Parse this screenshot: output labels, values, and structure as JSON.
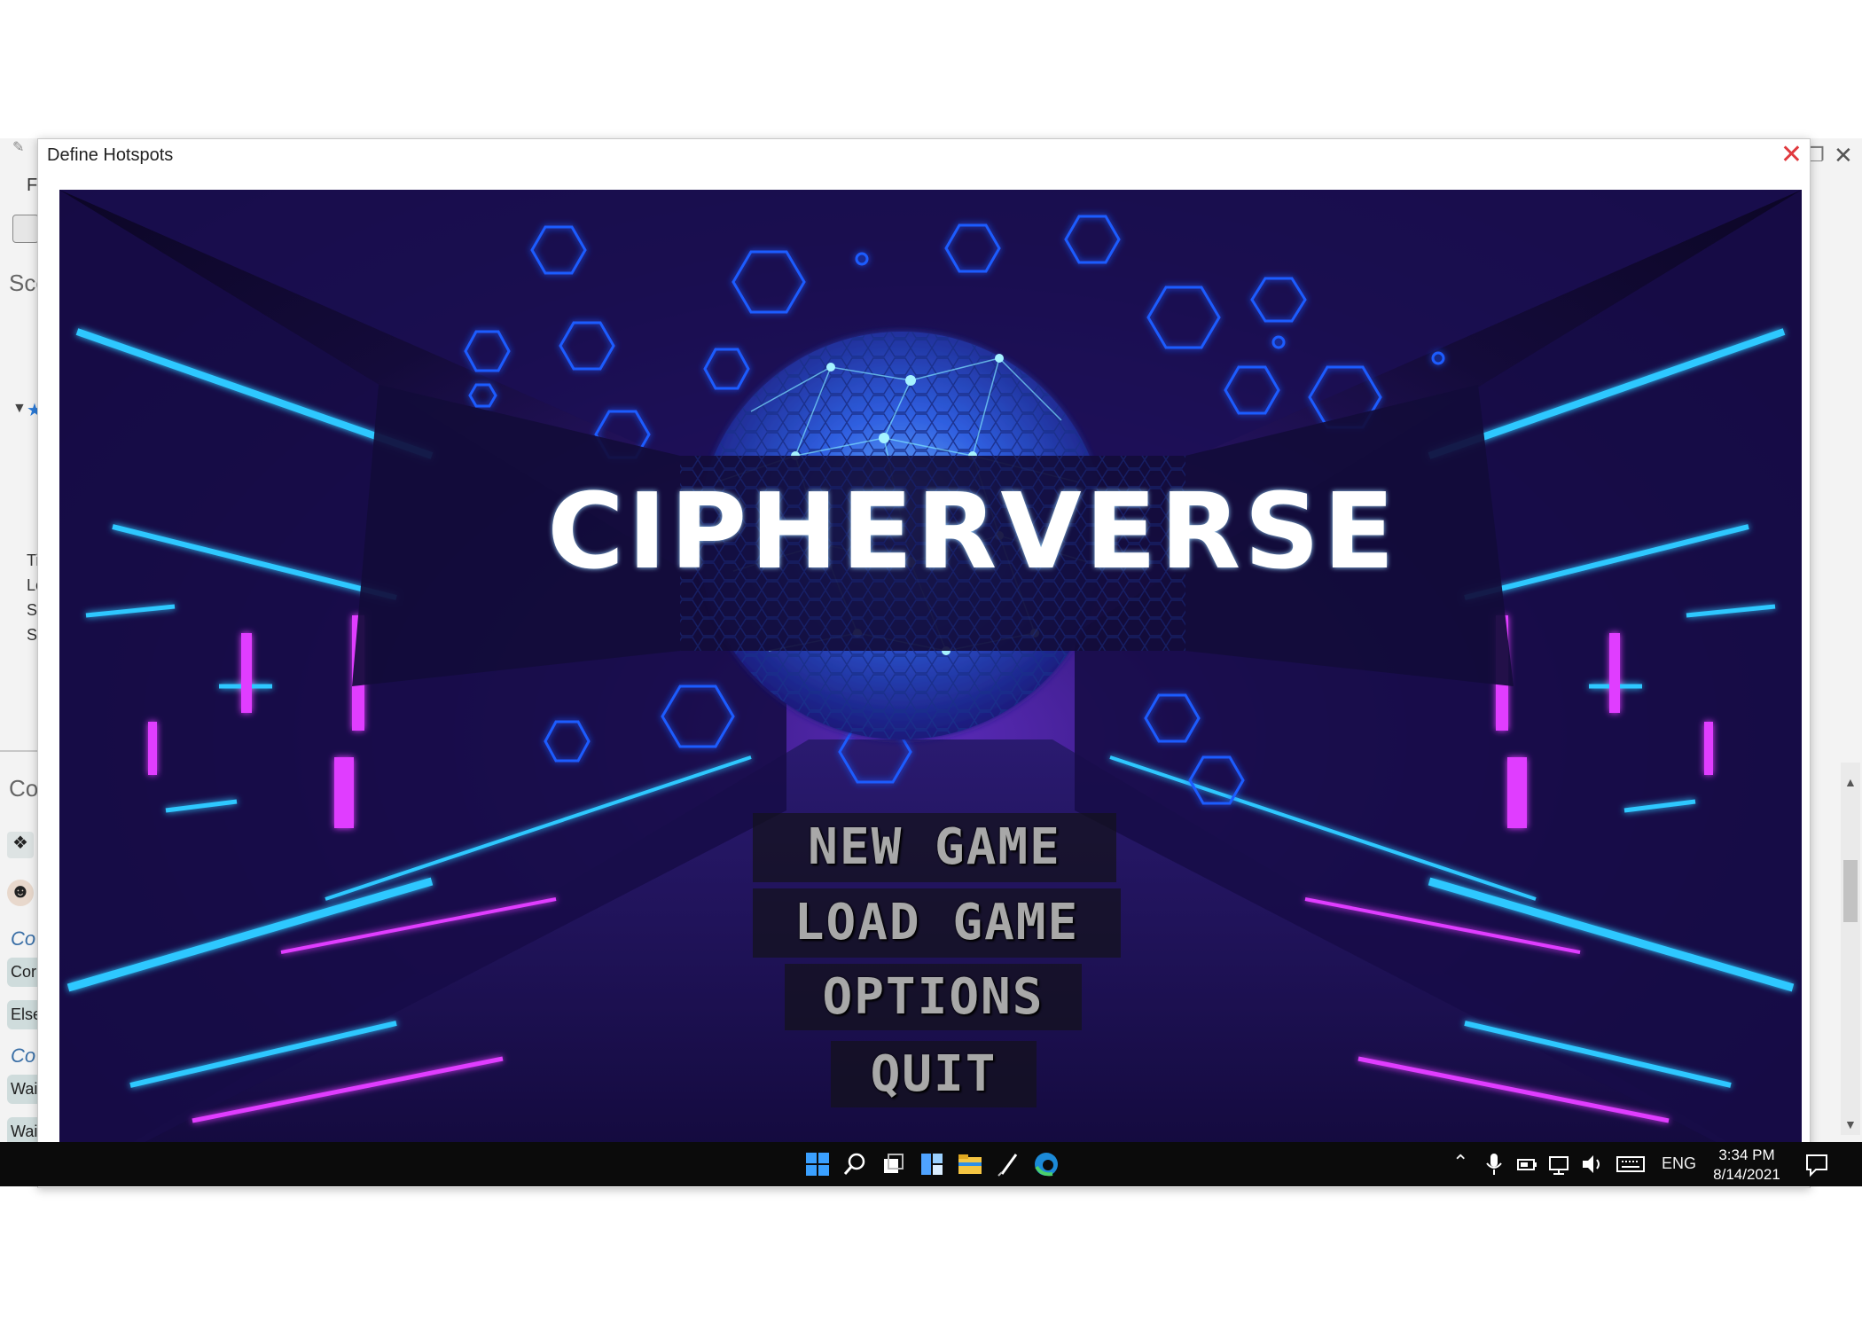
{
  "background_app": {
    "menu_letter": "F",
    "panel_label_1": "Sce",
    "panel_label_2": "Co",
    "list_items": [
      "Ti",
      "Lo",
      "Se",
      "St"
    ],
    "chips": [
      "Cor",
      "Else",
      "Wai",
      "Wai"
    ],
    "italic_labels": [
      "Co",
      "Co"
    ]
  },
  "dialog": {
    "title": "Define Hotspots",
    "close_glyph": "✕"
  },
  "game": {
    "logo_text": "CIPHERVERSE",
    "menu": {
      "new_game": "NEW GAME",
      "load_game": "LOAD GAME",
      "options": "OPTIONS",
      "quit": "QUIT"
    }
  },
  "taskbar": {
    "icons": [
      "windows-start-icon",
      "search-icon",
      "task-view-icon",
      "widgets-icon",
      "file-explorer-icon",
      "pen-icon",
      "edge-browser-icon"
    ],
    "tray_language": "ENG",
    "time": "3:34 PM",
    "date": "8/14/2021"
  },
  "colors": {
    "neon_cyan": "#2fc8ff",
    "neon_magenta": "#e03cff",
    "hexagon_blue": "#1f5cff",
    "dialog_close": "#e0393e"
  }
}
